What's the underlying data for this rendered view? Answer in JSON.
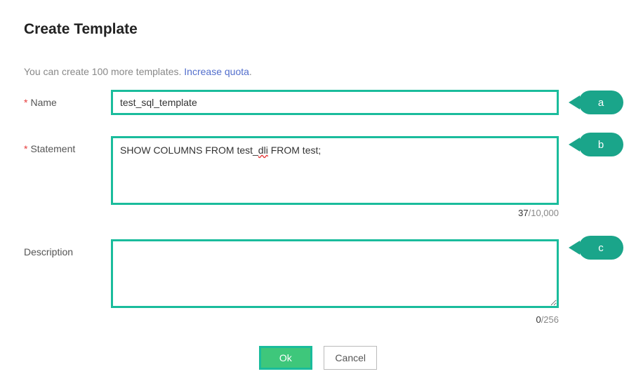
{
  "title": "Create Template",
  "quota": {
    "text_prefix": "You can create 100 more templates. ",
    "link": "Increase quota",
    "text_suffix": "."
  },
  "labels": {
    "name": "Name",
    "statement": "Statement",
    "description": "Description"
  },
  "values": {
    "name": "test_sql_template",
    "statement_pre": "SHOW COLUMNS FROM test_",
    "statement_err": "dli",
    "statement_post": " FROM test;",
    "description": ""
  },
  "counters": {
    "statement_cur": "37",
    "statement_max": "/10,000",
    "description_cur": "0",
    "description_max": "/256"
  },
  "buttons": {
    "ok": "Ok",
    "cancel": "Cancel"
  },
  "callouts": {
    "a": "a",
    "b": "b",
    "c": "c"
  }
}
